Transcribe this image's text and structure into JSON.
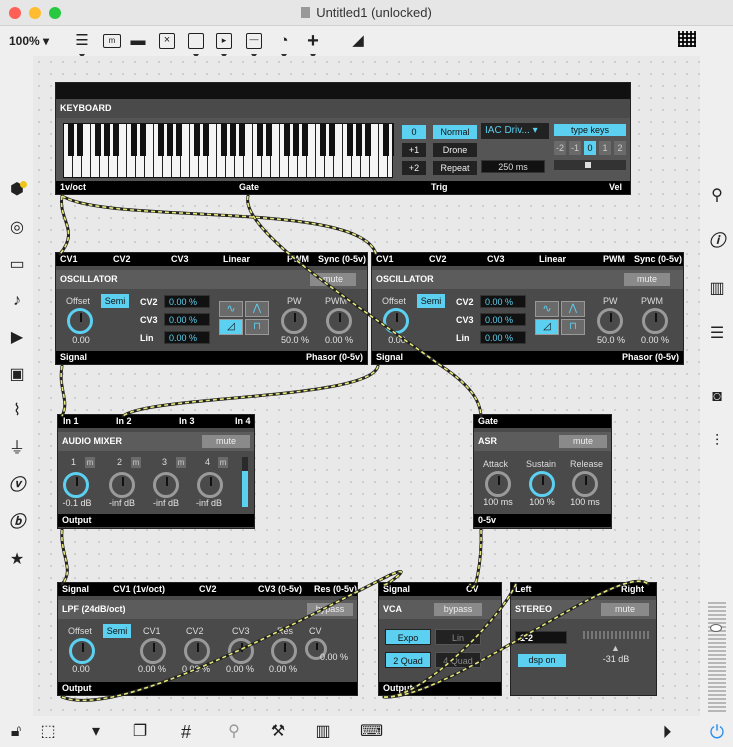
{
  "window": {
    "title": "Untitled1 (unlocked)",
    "zoom": "100%",
    "traffic": {
      "close": "#fe5f57",
      "minimize": "#febc2e",
      "zoom": "#28c840"
    }
  },
  "toolbar": {
    "icons": [
      "new-object-icon",
      "message-icon",
      "comment-icon",
      "button-icon",
      "toggle-icon",
      "number-icon",
      "slider-icon",
      "dial-icon",
      "add-icon",
      "paint-bucket-icon",
      "grid-view-icon"
    ]
  },
  "left_sidebar": {
    "icons": [
      "packages-icon",
      "target-icon",
      "device-icon",
      "music-icon",
      "video-play-icon",
      "image-icon",
      "paperclip-icon",
      "plug-icon",
      "v-icon",
      "b-icon",
      "star-icon"
    ]
  },
  "right_sidebar": {
    "icons": [
      "search-icon",
      "info-icon",
      "book-icon",
      "list-icon",
      "camera-icon",
      "mixer-icon"
    ]
  },
  "bottom_bar": {
    "icons": [
      "lock-icon",
      "presentation-icon",
      "comment-icon",
      "layers-icon",
      "grid-icon",
      "pin-icon",
      "wrench-icon",
      "piano-icon",
      "keyboard-icon",
      "play-icon",
      "power-icon"
    ]
  },
  "keyboard": {
    "title": "KEYBOARD",
    "octave": [
      "0",
      "+1",
      "+2"
    ],
    "modes": [
      "Normal",
      "Drone",
      "Repeat"
    ],
    "device": "IAC Driv...",
    "time": "250 ms",
    "type_keys": "type keys",
    "octave_shift": [
      "-2",
      "-1",
      "0",
      "1",
      "2"
    ],
    "outlets": [
      "1v/oct",
      "Gate",
      "Trig",
      "Vel"
    ]
  },
  "osc1": {
    "inlets": [
      "CV1",
      "CV2",
      "CV3",
      "Linear",
      "PWM",
      "Sync (0-5v)"
    ],
    "title": "OSCILLATOR",
    "mute": "mute",
    "offset_label": "Offset",
    "semi": "Semi",
    "offset_value": "0.00",
    "cv2_label": "CV2",
    "cv2": "0.00 %",
    "cv3_label": "CV3",
    "cv3": "0.00 %",
    "lin_label": "Lin",
    "lin": "0.00 %",
    "pw_label": "PW",
    "pw": "50.0 %",
    "pwm_label": "PWM",
    "pwm": "0.00 %",
    "outlets": [
      "Signal",
      "Phasor (0-5v)"
    ]
  },
  "osc2": {
    "inlets": [
      "CV1",
      "CV2",
      "CV3",
      "Linear",
      "PWM",
      "Sync (0-5v)"
    ],
    "title": "OSCILLATOR",
    "mute": "mute",
    "offset_label": "Offset",
    "semi": "Semi",
    "offset_value": "0.00",
    "cv2_label": "CV2",
    "cv2": "0.00 %",
    "cv3_label": "CV3",
    "cv3": "0.00 %",
    "lin_label": "Lin",
    "lin": "0.00 %",
    "pw_label": "PW",
    "pw": "50.0 %",
    "pwm_label": "PWM",
    "pwm": "0.00 %",
    "outlets": [
      "Signal",
      "Phasor (0-5v)"
    ]
  },
  "mixer": {
    "inlets": [
      "In 1",
      "In 2",
      "In 3",
      "In 4"
    ],
    "title": "AUDIO MIXER",
    "mute": "mute",
    "channels": [
      {
        "n": "1",
        "m": "m",
        "v": "-0.1 dB"
      },
      {
        "n": "2",
        "m": "m",
        "v": "-inf dB"
      },
      {
        "n": "3",
        "m": "m",
        "v": "-inf dB"
      },
      {
        "n": "4",
        "m": "m",
        "v": "-inf dB"
      }
    ],
    "outlet": "Output"
  },
  "asr": {
    "inlet": "Gate",
    "title": "ASR",
    "mute": "mute",
    "attack_label": "Attack",
    "attack": "100 ms",
    "sustain_label": "Sustain",
    "sustain": "100 %",
    "release_label": "Release",
    "release": "100 ms",
    "outlet": "0-5v"
  },
  "lpf": {
    "inlets": [
      "Signal",
      "CV1 (1v/oct)",
      "CV2",
      "CV3 (0-5v)",
      "Res (0-5v)"
    ],
    "title": "LPF (24dB/oct)",
    "bypass": "bypass",
    "offset_label": "Offset",
    "semi": "Semi",
    "offset_value": "0.00",
    "cv1_label": "CV1",
    "cv1": "0.00 %",
    "cv2_label": "CV2",
    "cv2": "0.00 %",
    "cv3_label": "CV3",
    "cv3": "0.00 %",
    "res_label": "Res",
    "res": "0.00 %",
    "cv_label": "CV",
    "cv": "0.00 %",
    "outlet": "Output"
  },
  "vca": {
    "inlets": [
      "Signal",
      "CV"
    ],
    "title": "VCA",
    "bypass": "bypass",
    "expo": "Expo",
    "lin": "Lin",
    "quad2": "2 Quad",
    "quad4": "4 Quad",
    "outlet": "Output"
  },
  "stereo": {
    "inlets": [
      "Left",
      "Right"
    ],
    "title": "STEREO",
    "mute": "mute",
    "channels": "1-2",
    "dsp": "dsp on",
    "level": "-31 dB"
  }
}
